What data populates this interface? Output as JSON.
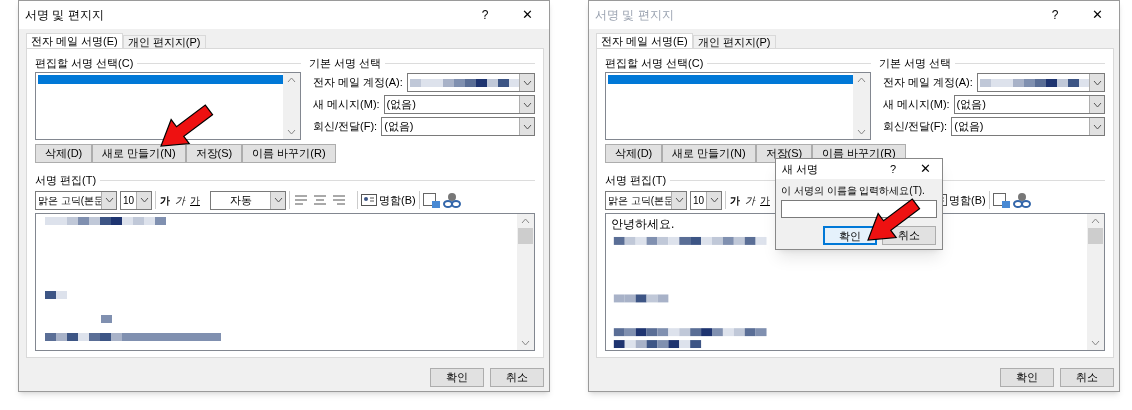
{
  "dialogs": [
    {
      "title": "서명 및 편지지",
      "active": true,
      "help": "?",
      "close": "✕",
      "arrow": true,
      "tabs": [
        {
          "label": "전자 메일 서명(E)",
          "selected": true
        },
        {
          "label": "개인 편지지(P)",
          "selected": false
        }
      ],
      "list_label": "편집할 서명 선택(C)",
      "list_items": [
        {
          "selected": true
        }
      ],
      "list_buttons": [
        {
          "label": "삭제(D)"
        },
        {
          "label": "새로 만들기(N)"
        },
        {
          "label": "저장(S)"
        },
        {
          "label": "이름 바꾸기(R)"
        }
      ],
      "default_label": "기본 서명 선택",
      "default_fields": [
        {
          "label": "전자 메일 계정(A):"
        },
        {
          "label": "새 메시지(M):",
          "value": "(없음)"
        },
        {
          "label": "회신/전달(F):",
          "value": "(없음)"
        }
      ],
      "editor_label": "서명 편집(T)",
      "font": "맑은 고딕(본문",
      "size": "10",
      "style_buttons": [
        {
          "kind": "bold",
          "label": "가"
        },
        {
          "kind": "italic",
          "label": "가"
        },
        {
          "kind": "underline",
          "label": "가"
        }
      ],
      "font_color_label": "자동",
      "card_button": "명함(B)",
      "footer_buttons": [
        {
          "label": "확인"
        },
        {
          "label": "취소"
        }
      ]
    },
    {
      "title": "서명 및 편지지",
      "active": false,
      "help": "?",
      "close": "✕",
      "arrow": false,
      "tabs": [
        {
          "label": "전자 메일 서명(E)",
          "selected": true
        },
        {
          "label": "개인 편지지(P)",
          "selected": false
        }
      ],
      "list_label": "편집할 서명 선택(C)",
      "list_items": [
        {
          "selected": true
        }
      ],
      "list_buttons": [
        {
          "label": "삭제(D)"
        },
        {
          "label": "새로 만들기(N)"
        },
        {
          "label": "저장(S)"
        },
        {
          "label": "이름 바꾸기(R)"
        }
      ],
      "default_label": "기본 서명 선택",
      "default_fields": [
        {
          "label": "전자 메일 계정(A):"
        },
        {
          "label": "새 메시지(M):",
          "value": "(없음)"
        },
        {
          "label": "회신/전달(F):",
          "value": "(없음)"
        }
      ],
      "editor_label": "서명 편집(T)",
      "font": "맑은 고딕(본문",
      "size": "10",
      "style_buttons": [
        {
          "kind": "bold",
          "label": "가"
        },
        {
          "kind": "italic",
          "label": "가"
        },
        {
          "kind": "underline",
          "label": "가"
        }
      ],
      "card_button": "명함(B)",
      "editor_text": "안녕하세요.",
      "footer_buttons": [
        {
          "label": "확인"
        },
        {
          "label": "취소"
        }
      ],
      "modal": {
        "title": "새 서명",
        "help": "?",
        "close": "✕",
        "prompt": "이 서명의 이름을 입력하세요(T).",
        "arrow": true,
        "buttons": [
          {
            "label": "확인",
            "focused": true
          },
          {
            "label": "취소",
            "focused": false
          }
        ]
      }
    }
  ]
}
